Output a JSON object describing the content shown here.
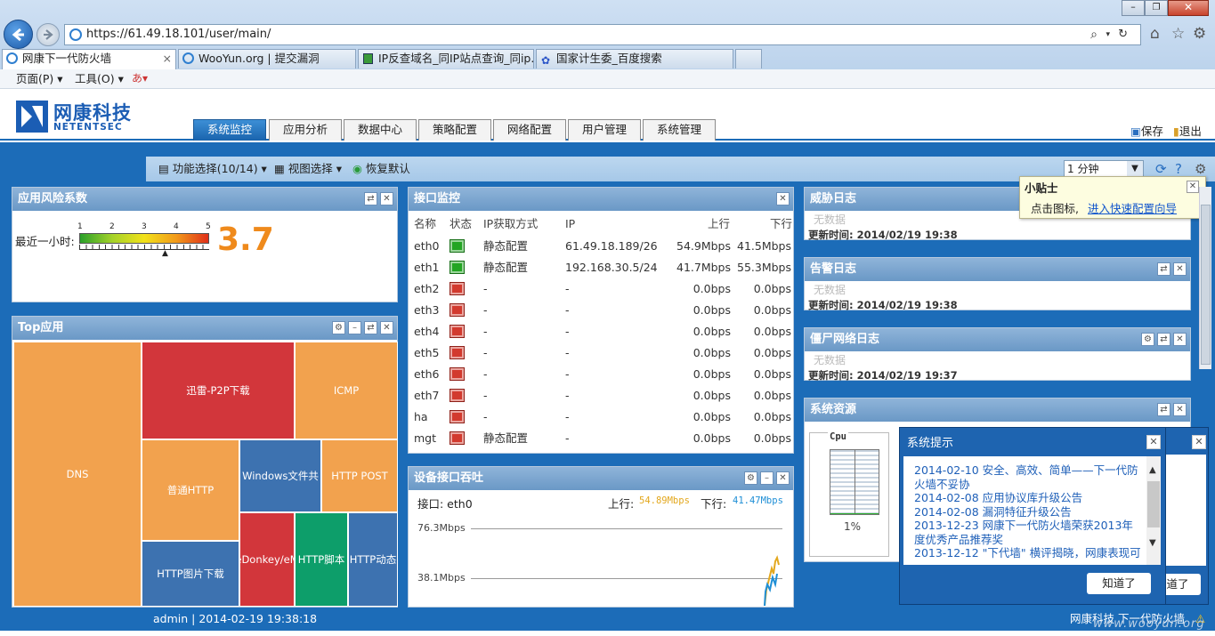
{
  "browser": {
    "url": "https://61.49.18.101/user/main/",
    "tabs": [
      "网康下一代防火墙",
      "WooYun.org | 提交漏洞",
      "IP反查域名_同IP站点查询_同ip...",
      "国家计生委_百度搜索"
    ],
    "menu": [
      "页面(P)",
      "工具(O)"
    ]
  },
  "app": {
    "brand_cn": "网康科技",
    "brand_en": "NETENTSEC",
    "nav_tabs": [
      "系统监控",
      "应用分析",
      "数据中心",
      "策略配置",
      "网络配置",
      "用户管理",
      "系统管理"
    ],
    "save": "保存",
    "logout": "退出",
    "toolbar": {
      "func": "功能选择(10/14)",
      "view": "视图选择",
      "reset": "恢复默认",
      "interval": "1 分钟"
    }
  },
  "risk": {
    "title": "应用风险系数",
    "label": "最近一小时:",
    "score": "3.7",
    "ticks": [
      "1",
      "2",
      "3",
      "4",
      "5"
    ]
  },
  "top_apps": {
    "title": "Top应用",
    "tiles": [
      "DNS",
      "迅雷-P2P下载",
      "ICMP",
      "普通HTTP",
      "Windows文件共",
      "HTTP POST",
      "HTTP图片下载",
      "eDonkey/eM",
      "HTTP脚本",
      "HTTP动态"
    ]
  },
  "iface": {
    "title": "接口监控",
    "headers": [
      "名称",
      "状态",
      "IP获取方式",
      "IP",
      "上行",
      "下行"
    ],
    "rows": [
      {
        "name": "eth0",
        "up": true,
        "mode": "静态配置",
        "ip": "61.49.18.189/26",
        "tx": "54.9Mbps",
        "rx": "41.5Mbps"
      },
      {
        "name": "eth1",
        "up": true,
        "mode": "静态配置",
        "ip": "192.168.30.5/24",
        "tx": "41.7Mbps",
        "rx": "55.3Mbps"
      },
      {
        "name": "eth2",
        "up": false,
        "mode": "-",
        "ip": "-",
        "tx": "0.0bps",
        "rx": "0.0bps"
      },
      {
        "name": "eth3",
        "up": false,
        "mode": "-",
        "ip": "-",
        "tx": "0.0bps",
        "rx": "0.0bps"
      },
      {
        "name": "eth4",
        "up": false,
        "mode": "-",
        "ip": "-",
        "tx": "0.0bps",
        "rx": "0.0bps"
      },
      {
        "name": "eth5",
        "up": false,
        "mode": "-",
        "ip": "-",
        "tx": "0.0bps",
        "rx": "0.0bps"
      },
      {
        "name": "eth6",
        "up": false,
        "mode": "-",
        "ip": "-",
        "tx": "0.0bps",
        "rx": "0.0bps"
      },
      {
        "name": "eth7",
        "up": false,
        "mode": "-",
        "ip": "-",
        "tx": "0.0bps",
        "rx": "0.0bps"
      },
      {
        "name": "ha",
        "up": false,
        "mode": "-",
        "ip": "-",
        "tx": "0.0bps",
        "rx": "0.0bps"
      },
      {
        "name": "mgt",
        "up": false,
        "mode": "静态配置",
        "ip": "-",
        "tx": "0.0bps",
        "rx": "0.0bps"
      }
    ]
  },
  "throughput": {
    "title": "设备接口吞吐",
    "iface_label": "接口: eth0",
    "up_label": "上行:",
    "up_value": "54.89Mbps",
    "down_label": "下行:",
    "down_value": "41.47Mbps",
    "y_ticks": [
      "76.3Mbps",
      "38.1Mbps"
    ],
    "up_color": "#e3a81e",
    "down_color": "#1f8fd6"
  },
  "logs": [
    {
      "title": "威胁日志",
      "empty": "无数据",
      "updated": "更新时间: 2014/02/19 19:38"
    },
    {
      "title": "告警日志",
      "empty": "无数据",
      "updated": "更新时间: 2014/02/19 19:38"
    },
    {
      "title": "僵尸网络日志",
      "empty": "无数据",
      "updated": "更新时间: 2014/02/19 19:37"
    }
  ],
  "sysres": {
    "title": "系统资源",
    "cpu_label": "Cpu",
    "cpu_pct": "1%",
    "cpu_fraction": 0.01
  },
  "tooltip": {
    "title": "小贴士",
    "text": "点击图标,",
    "link": "进入快速配置向导"
  },
  "sys_notice": {
    "title": "系统提示",
    "items": [
      "2014-02-10 安全、高效、简单——下一代防火墙不妥协",
      "2014-02-08 应用协议库升级公告",
      "2014-02-08 漏洞特征升级公告",
      "2013-12-23 网康下一代防火墙荣获2013年度优秀产品推荐奖",
      "2013-12-12 \"下代墙\" 横评揭晓，网康表现可"
    ],
    "ok": "知道了",
    "ok_behind": "道了"
  },
  "footer": {
    "user": "admin | 2014-02-19 19:38:18",
    "brand": "网康科技 下一代防火墙",
    "watermark": "www.wooyun.org"
  }
}
